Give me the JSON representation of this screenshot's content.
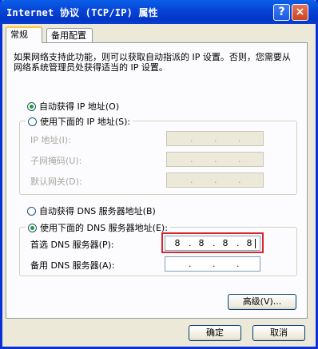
{
  "window": {
    "title": "Internet 协议 (TCP/IP) 属性",
    "help_glyph": "?",
    "close_glyph": "×"
  },
  "tabs": [
    {
      "label": "常规"
    },
    {
      "label": "备用配置"
    }
  ],
  "description": "如果网络支持此功能，则可以获取自动指派的 IP 设置。否则，您需要从网络系统管理员处获得适当的 IP 设置。",
  "ip": {
    "auto_label": "自动获得 IP 地址(O)",
    "manual_label": "使用下面的 IP 地址(S):",
    "fields": [
      {
        "label": "IP 地址(I):"
      },
      {
        "label": "子网掩码(U):"
      },
      {
        "label": "默认网关(D):"
      }
    ]
  },
  "dns": {
    "auto_label": "自动获得 DNS 服务器地址(B)",
    "manual_label": "使用下面的 DNS 服务器地址(E):",
    "preferred_label": "首选 DNS 服务器(P):",
    "preferred_octets": [
      "8",
      "8",
      "8",
      "8"
    ],
    "alternate_label": "备用 DNS 服务器(A):"
  },
  "dot": ".",
  "buttons": {
    "advanced": "高级(V)...",
    "ok": "确定",
    "cancel": "取消"
  },
  "colors": {
    "titlebar": "#0a5fe8",
    "highlight": "#d7262a",
    "selected_radio": "#21a121"
  }
}
